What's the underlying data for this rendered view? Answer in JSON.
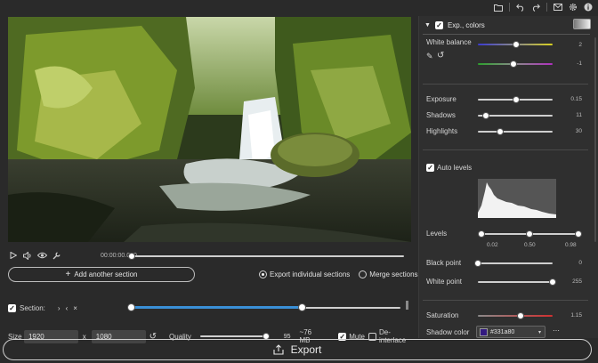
{
  "toolbar": {
    "icons": [
      "folder-icon",
      "undo-icon",
      "redo-icon",
      "mail-icon",
      "gear-icon",
      "info-icon"
    ]
  },
  "player": {
    "timecode": "00:00:00.000",
    "position_fraction": 0.0
  },
  "sections": {
    "add_label": "Add another section",
    "radio_individual": "Export individual sections",
    "radio_merge": "Merge sections",
    "selected": "individual",
    "section_label": "Section:",
    "section_checked": true,
    "nav_icons": [
      "prev-icon",
      "next-icon",
      "remove-icon"
    ]
  },
  "output": {
    "size_label": "Size",
    "width": "1920",
    "x_label": "x",
    "height": "1080",
    "quality_label": "Quality",
    "quality_value": "95",
    "quality_fraction": 0.95,
    "est_size": "~76 MB",
    "mute_label": "Mute",
    "mute_checked": true,
    "deinterlace_label": "De-interlace",
    "deinterlace_checked": false
  },
  "export_label": "Export",
  "panel": {
    "title": "Exp., colors",
    "white_balance_label": "White balance",
    "wb_temp_value": "2",
    "wb_tint_value": "-1",
    "exposure_label": "Exposure",
    "exposure_value": "0.15",
    "shadows_label": "Shadows",
    "shadows_value": "11",
    "highlights_label": "Highlights",
    "highlights_value": "30",
    "auto_levels_label": "Auto levels",
    "levels_label": "Levels",
    "levels_low": "0.02",
    "levels_mid": "0.50",
    "levels_high": "0.98",
    "black_point_label": "Black point",
    "black_point_value": "0",
    "white_point_label": "White point",
    "white_point_value": "255",
    "saturation_label": "Saturation",
    "saturation_value": "1.15",
    "shadow_color_label": "Shadow color",
    "shadow_color_value": "#331a80"
  },
  "colors": {
    "accent": "#3a8fd6",
    "background": "#2a2a2a",
    "panel": "#2f2f2f"
  }
}
